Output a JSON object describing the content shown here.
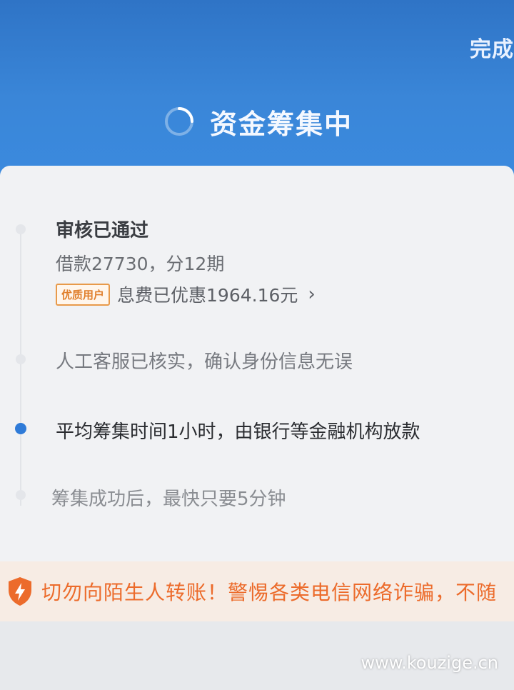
{
  "header": {
    "done_label": "完成",
    "title": "资金筹集中",
    "icon": "loading-spinner-icon"
  },
  "steps": [
    {
      "title": "审核已通过",
      "subtitle": "借款27730，分12期",
      "badge": "优质用户",
      "discount_text": "息费已优惠1964.16元"
    },
    {
      "text": "人工客服已核实，确认身份信息无误"
    },
    {
      "text": "平均筹集时间1小时，由银行等金融机构放款"
    },
    {
      "text": "筹集成功后，最快只要5分钟"
    }
  ],
  "warning": {
    "icon": "shield-bolt-icon",
    "text": "切勿向陌生人转账！警惕各类电信网络诈骗，不随"
  },
  "watermark": "www.kouzige.cn",
  "colors": {
    "header_blue": "#3a86d8",
    "accent_blue": "#2f7bd8",
    "warning_orange": "#ec6b2b",
    "badge_orange": "#e07f2c"
  }
}
